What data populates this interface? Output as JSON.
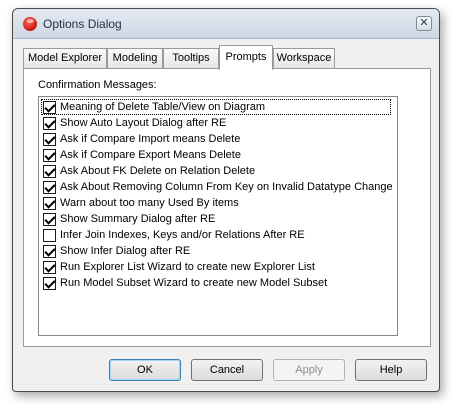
{
  "window": {
    "title": "Options Dialog",
    "close_glyph": "✕"
  },
  "tabs": [
    {
      "label": "Model Explorer",
      "active": false
    },
    {
      "label": "Modeling",
      "active": false
    },
    {
      "label": "Tooltips",
      "active": false
    },
    {
      "label": "Prompts",
      "active": true
    },
    {
      "label": "Workspace",
      "active": false
    }
  ],
  "panel": {
    "group_label": "Confirmation Messages:",
    "items": [
      {
        "label": "Meaning of Delete Table/View on Diagram",
        "checked": true
      },
      {
        "label": "Show Auto Layout Dialog after RE",
        "checked": true
      },
      {
        "label": "Ask if Compare Import means Delete",
        "checked": true
      },
      {
        "label": "Ask if Compare Export Means Delete",
        "checked": true
      },
      {
        "label": "Ask About FK Delete on Relation Delete",
        "checked": true
      },
      {
        "label": "Ask About Removing Column From Key on Invalid Datatype Change",
        "checked": true
      },
      {
        "label": "Warn about too many Used By items",
        "checked": true
      },
      {
        "label": "Show Summary Dialog after RE",
        "checked": true
      },
      {
        "label": "Infer Join Indexes, Keys and/or Relations After RE",
        "checked": false
      },
      {
        "label": "Show Infer Dialog after RE",
        "checked": true
      },
      {
        "label": "Run Explorer List Wizard to create new Explorer List",
        "checked": true
      },
      {
        "label": "Run Model Subset Wizard to create new Model Subset",
        "checked": true
      }
    ]
  },
  "buttons": {
    "ok": "OK",
    "cancel": "Cancel",
    "apply": "Apply",
    "help": "Help"
  },
  "colors": {
    "accent": "#3c7fb1",
    "app_icon": "#c8140c"
  }
}
